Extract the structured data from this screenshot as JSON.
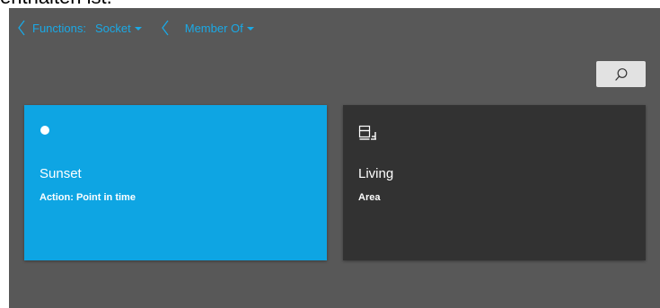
{
  "header": {
    "partial_text": "enthalten ist."
  },
  "breadcrumb": {
    "functions_label": "Functions:",
    "functions_value": "Socket",
    "relation_value": "Member Of"
  },
  "cards": [
    {
      "title": "Sunset",
      "subtitle": "Action: Point in time",
      "icon": "dot-icon",
      "color": "#0ea5e3"
    },
    {
      "title": "Living",
      "subtitle": "Area",
      "icon": "room-sofa-icon",
      "color": "#323232"
    }
  ],
  "search": {
    "icon": "search-icon"
  },
  "colors": {
    "accent": "#1aa9e6",
    "background": "#585858",
    "card_dark": "#323232"
  }
}
